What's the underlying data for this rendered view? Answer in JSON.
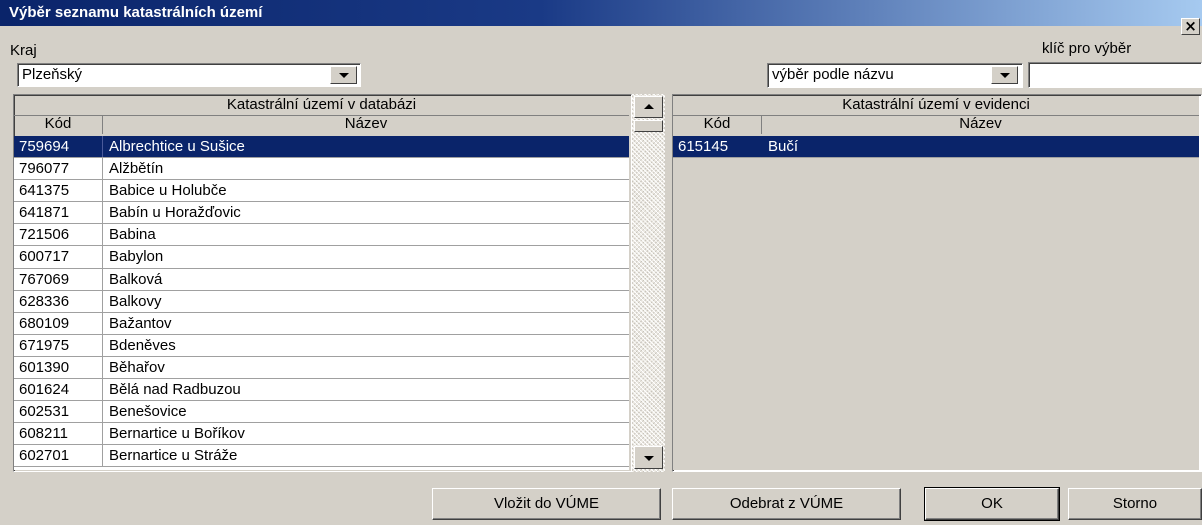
{
  "window": {
    "title": "Výběr seznamu katastrálních území",
    "close_glyph": "×"
  },
  "filters": {
    "kraj_label": "Kraj",
    "kraj_value": "Plzeňský",
    "mode_value": "výběr podle názvu",
    "key_label": "klíč pro výběr",
    "key_value": ""
  },
  "left_list": {
    "group_header": "Katastrální území v databázi",
    "col_code": "Kód",
    "col_name": "Název",
    "rows": [
      {
        "code": "759694",
        "name": "Albrechtice u Sušice"
      },
      {
        "code": "796077",
        "name": "Alžbětín"
      },
      {
        "code": "641375",
        "name": "Babice u Holubče"
      },
      {
        "code": "641871",
        "name": "Babín u Horažďovic"
      },
      {
        "code": "721506",
        "name": "Babina"
      },
      {
        "code": "600717",
        "name": "Babylon"
      },
      {
        "code": "767069",
        "name": "Balková"
      },
      {
        "code": "628336",
        "name": "Balkovy"
      },
      {
        "code": "680109",
        "name": "Bažantov"
      },
      {
        "code": "671975",
        "name": "Bdeněves"
      },
      {
        "code": "601390",
        "name": "Běhařov"
      },
      {
        "code": "601624",
        "name": "Bělá nad Radbuzou"
      },
      {
        "code": "602531",
        "name": "Benešovice"
      },
      {
        "code": "608211",
        "name": "Bernartice u Boříkov"
      },
      {
        "code": "602701",
        "name": "Bernartice u Stráže"
      }
    ],
    "selected_index": 0
  },
  "right_list": {
    "group_header": "Katastrální území v evidenci",
    "col_code": "Kód",
    "col_name": "Název",
    "rows": [
      {
        "code": "615145",
        "name": "Bučí"
      }
    ],
    "selected_index": 0
  },
  "buttons": {
    "insert_label": "Vložit do VÚME",
    "remove_label": "Odebrat z VÚME",
    "ok_label": "OK",
    "cancel_label": "Storno"
  }
}
